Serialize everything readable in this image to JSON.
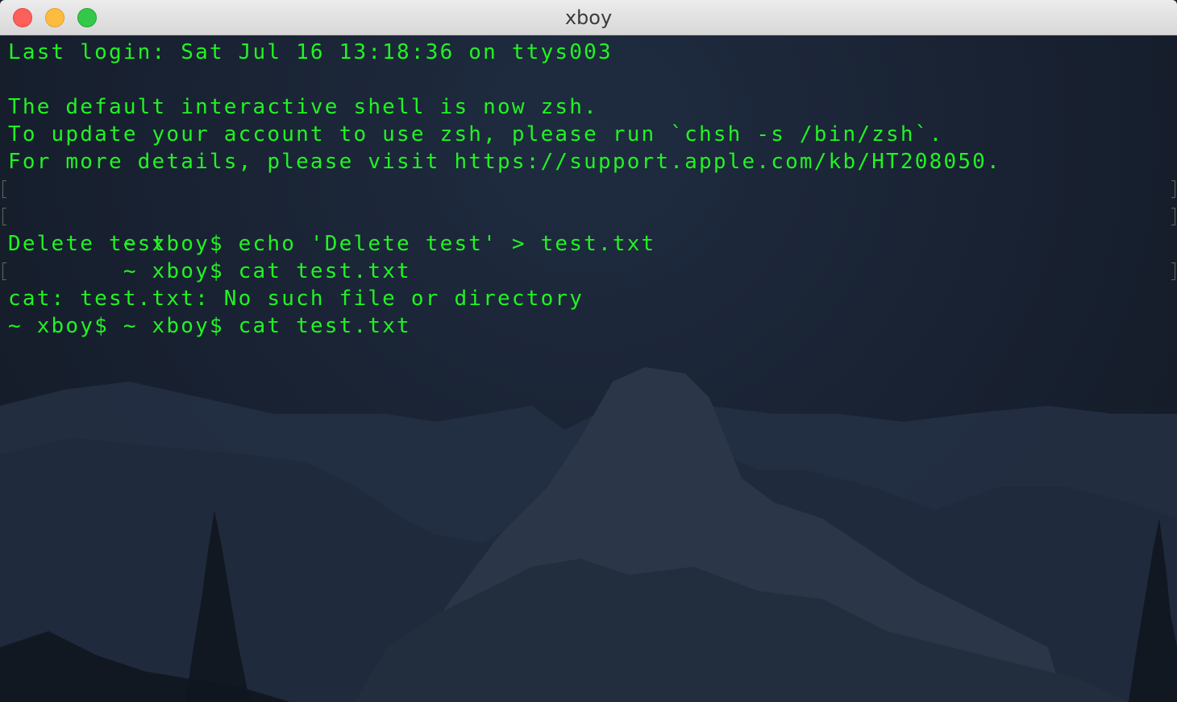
{
  "window": {
    "title": "xboy"
  },
  "terminal": {
    "text_color": "#21f323",
    "lines": [
      "Last login: Sat Jul 16 13:18:36 on ttys003",
      "",
      "The default interactive shell is now zsh.",
      "To update your account to use zsh, please run `chsh -s /bin/zsh`.",
      "For more details, please visit https://support.apple.com/kb/HT208050.",
      "~ xboy$ echo 'Delete test' > test.txt",
      "~ xboy$ cat test.txt",
      "Delete test",
      "~ xboy$ cat test.txt",
      "cat: test.txt: No such file or directory",
      "~ xboy$ "
    ]
  },
  "colors": {
    "close": "#fc605b",
    "minimize": "#fdbc40",
    "zoom": "#34c84a"
  },
  "icons": {
    "close": "close-icon",
    "minimize": "minimize-icon",
    "zoom": "zoom-icon"
  }
}
